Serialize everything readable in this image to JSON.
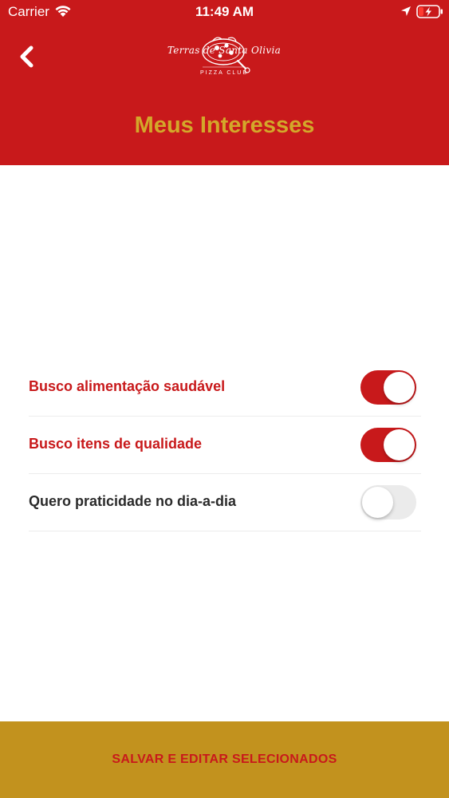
{
  "status_bar": {
    "carrier": "Carrier",
    "time": "11:49 AM"
  },
  "header": {
    "logo_script": "Terras de Santa Olivia",
    "logo_sub": "PIZZA CLUB",
    "title": "Meus Interesses",
    "title_color": "#d3a82a",
    "background_color": "#c8191b"
  },
  "interests": [
    {
      "label": "Busco alimentação saudável",
      "enabled": true
    },
    {
      "label": "Busco itens de qualidade",
      "enabled": true
    },
    {
      "label": "Quero praticidade no dia-a-dia",
      "enabled": false
    }
  ],
  "footer": {
    "save_label": "SALVAR E EDITAR SELECIONADOS",
    "background_color": "#c2921e"
  },
  "icons": {
    "back": "chevron-left-icon",
    "wifi": "wifi-icon",
    "location": "location-arrow-icon",
    "battery": "battery-charging-icon"
  }
}
